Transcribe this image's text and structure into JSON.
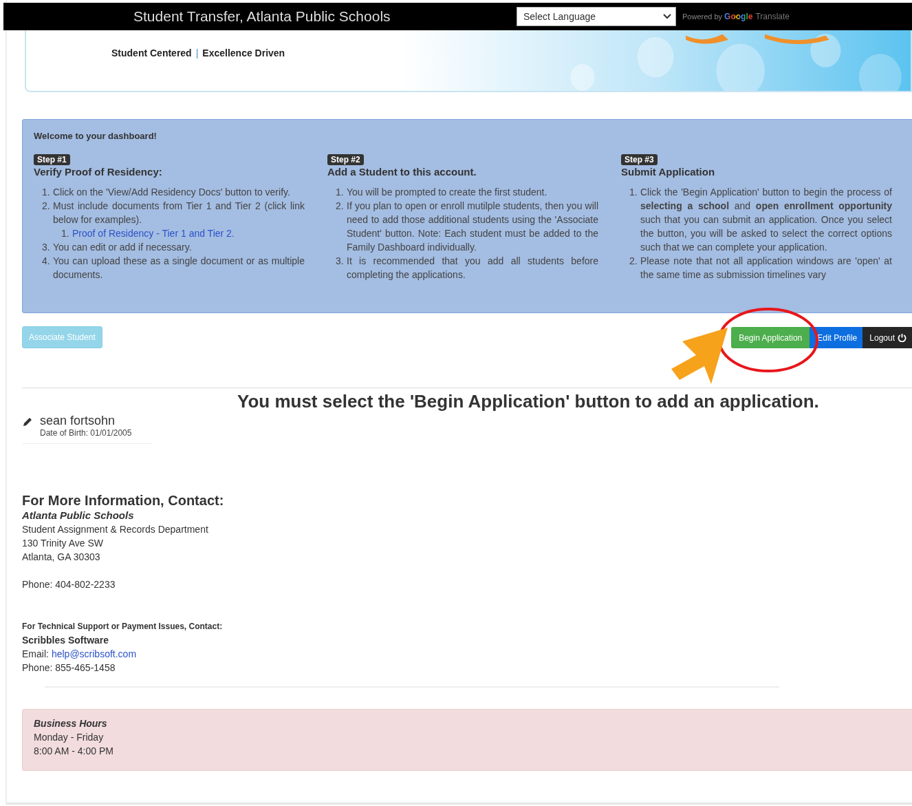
{
  "header": {
    "title": "Student Transfer, Atlanta Public Schools",
    "language_select": {
      "value": "Select Language"
    },
    "powered_by": "Powered by",
    "google": "Google",
    "translate": "Translate"
  },
  "banner": {
    "tagline_left": "Student Centered",
    "separator": "|",
    "tagline_right": "Excellence Driven"
  },
  "dashboard": {
    "welcome": "Welcome to your dashboard!",
    "steps": [
      {
        "badge": "Step #1",
        "title": "Verify Proof of Residency:",
        "items": [
          {
            "number": "1.",
            "text": "Click on the 'View/Add Residency Docs' button to verify."
          },
          {
            "number": "2.",
            "text": "Must include documents from Tier 1 and Tier 2 (click link below for examples).",
            "children": [
              {
                "number": "1.",
                "text": "Proof of Residency - Tier 1 and Tier 2."
              }
            ]
          },
          {
            "number": "3.",
            "text": "You can edit or add if necessary."
          },
          {
            "number": "4.",
            "text": "You can upload these as a single document or as multiple documents."
          }
        ]
      },
      {
        "badge": "Step #2",
        "title": "Add a Student to this account.",
        "items": [
          {
            "number": "1.",
            "text": "You will be prompted to create the first student."
          },
          {
            "number": "2.",
            "text": "If you plan to open or enroll mutilple students, then you will need to add those additional students using the 'Associate Student' button. Note: Each student must be added to the Family Dashboard individually."
          },
          {
            "number": "3.",
            "text": "It is recommended that you add all students before completing the applications."
          }
        ]
      },
      {
        "badge": "Step #3",
        "title": "Submit Application",
        "items": [
          {
            "number": "1.",
            "text": "Click the 'Begin Application' button to begin the process of **selecting a school** and **open enrollment opportunity** such that you can submit an application. Once you select the button, you will be asked to select the correct options such that we can complete your application."
          },
          {
            "number": "2.",
            "text": "Please note that not all application windows are 'open' at the same time as submission timelines vary"
          }
        ]
      }
    ]
  },
  "actions": {
    "associate": {
      "label": "Associate Student",
      "disabled": true
    },
    "buttons": [
      {
        "label": "Begin Application",
        "kind": "success"
      },
      {
        "label": "Edit Profile",
        "kind": "primary"
      },
      {
        "label": "Logout",
        "kind": "dark"
      }
    ]
  },
  "notice": "You must select the 'Begin Application' button to add an application.",
  "student": {
    "name": "sean fortsohn",
    "dob": "Date of Birth: 01/01/2005"
  },
  "contact": {
    "heading": "For More Information, Contact:",
    "org": "Atlanta Public Schools",
    "lines": [
      "Student Assignment & Records Department",
      "130 Trinity Ave SW",
      "Atlanta, GA 30303"
    ],
    "phone": "Phone: 404-802-2233",
    "support_heading": "For Technical Support or Payment Issues, Contact:",
    "vendor": "Scribbles Software",
    "email_label": "Email:",
    "email": "help@scribsoft.com",
    "support_phone": "Phone: 855-465-1458"
  },
  "hours": {
    "title": "Business Hours",
    "days": "Monday - Friday",
    "time": "8:00 AM - 4:00 PM"
  }
}
